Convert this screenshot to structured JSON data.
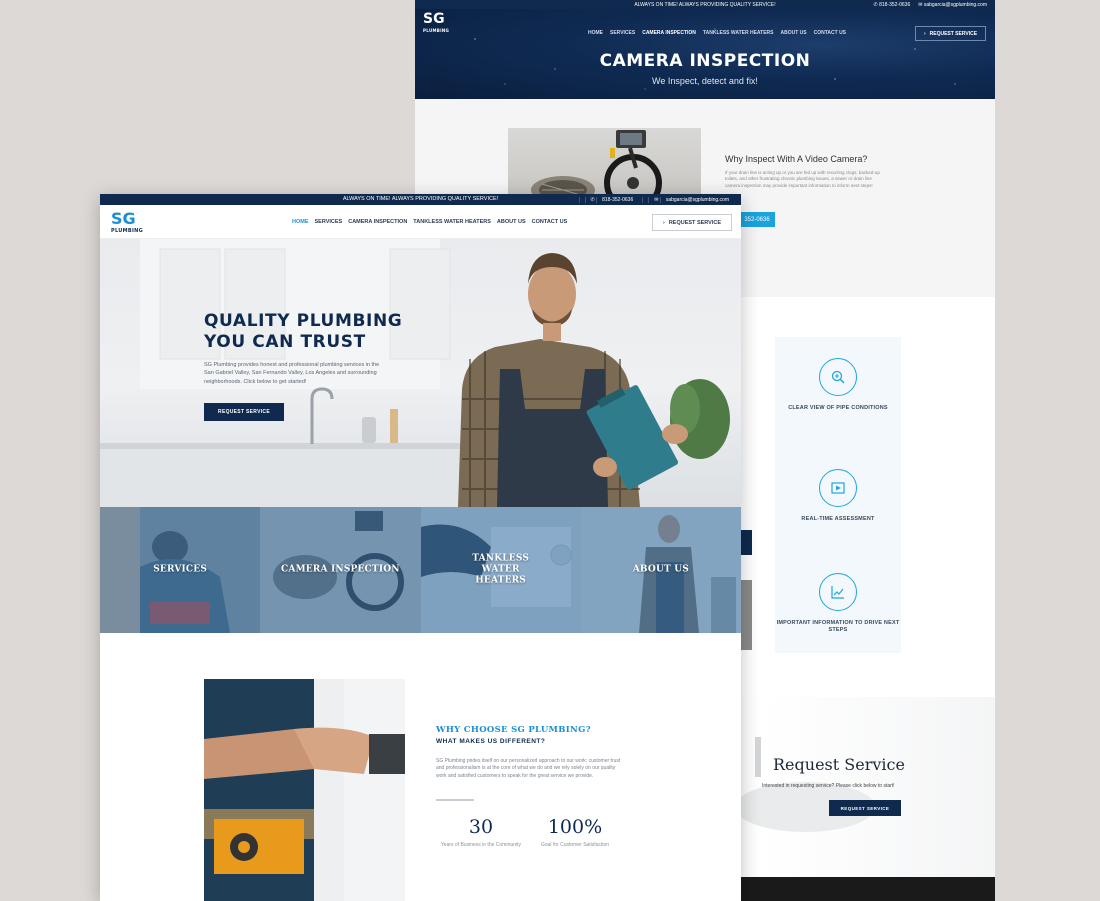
{
  "back": {
    "topbar": {
      "tagline": "ALWAYS ON TIME! ALWAYS PROVIDING QUALITY SERVICE!",
      "phone": "818-352-0636",
      "email": "sabgarcia@sgplumbing.com"
    },
    "logo": {
      "main": "SG",
      "sub": "PLUMBING"
    },
    "nav": [
      "HOME",
      "SERVICES",
      "CAMERA INSPECTION",
      "TANKLESS WATER HEATERS",
      "ABOUT US",
      "CONTACT US"
    ],
    "nav_active": "CAMERA INSPECTION",
    "request_btn": "REQUEST SERVICE",
    "hero": {
      "title": "CAMERA INSPECTION",
      "subtitle": "We Inspect, detect and fix!"
    },
    "why_camera": {
      "title": "Why Inspect With A Video Camera?",
      "text": "If your drain line is acting up or you are fed up with recurring clogs, backed-up toilets, and other frustrating chronic plumbing issues, a sewer or drain line camera inspection may provide important information to inform next steps!",
      "phone_btn": "352-0636"
    },
    "features": [
      {
        "icon": "magnifier-icon",
        "label": "CLEAR VIEW OF PIPE CONDITIONS"
      },
      {
        "icon": "video-icon",
        "label": "REAL-TIME ASSESSMENT"
      },
      {
        "icon": "chart-icon",
        "label": "IMPORTANT INFORMATION TO DRIVE NEXT STEPS"
      }
    ],
    "request_section": {
      "title": "Request Service",
      "text": "Interested in requesting service? Please click below to start!",
      "button": "REQUEST SERVICE"
    }
  },
  "front": {
    "topbar": {
      "tagline": "ALWAYS ON TIME! ALWAYS PROVIDING QUALITY SERVICE!",
      "phone": "818-352-0636",
      "email": "sabgarcia@sgplumbing.com"
    },
    "logo": {
      "main": "SG",
      "sub": "PLUMBING"
    },
    "nav": [
      "HOME",
      "SERVICES",
      "CAMERA INSPECTION",
      "TANKLESS WATER HEATERS",
      "ABOUT US",
      "CONTACT US"
    ],
    "nav_active": "HOME",
    "request_btn": "REQUEST SERVICE",
    "hero": {
      "title_line1": "QUALITY PLUMBING",
      "title_line2": "YOU CAN TRUST",
      "text": "SG Plumbing provides honest and professional plumbing services in the San Gabriel Valley, San Fernando Valley, Los Angeles and surrounding neighborhoods. Click below to get started!",
      "button": "REQUEST SERVICE"
    },
    "tiles": [
      "SERVICES",
      "CAMERA INSPECTION",
      "TANKLESS WATER HEATERS",
      "ABOUT US"
    ],
    "why": {
      "title": "WHY CHOOSE SG PLUMBING?",
      "subtitle": "WHAT MAKES US DIFFERENT?",
      "text": "SG Plumbing prides itself on our personalized approach to our work; customer trust and professionalism is at the core of what we do and we rely solely on our quality work and satisfied customers to speak for the great service we provide.",
      "stats": [
        {
          "value": "30",
          "label": "Years of Business in the Community"
        },
        {
          "value": "100%",
          "label": "Goal for Customer Satisfaction"
        }
      ]
    }
  },
  "colors": {
    "navy": "#0f2a4e",
    "accent": "#1c8ed6",
    "tile_overlay": "#3c78af"
  }
}
